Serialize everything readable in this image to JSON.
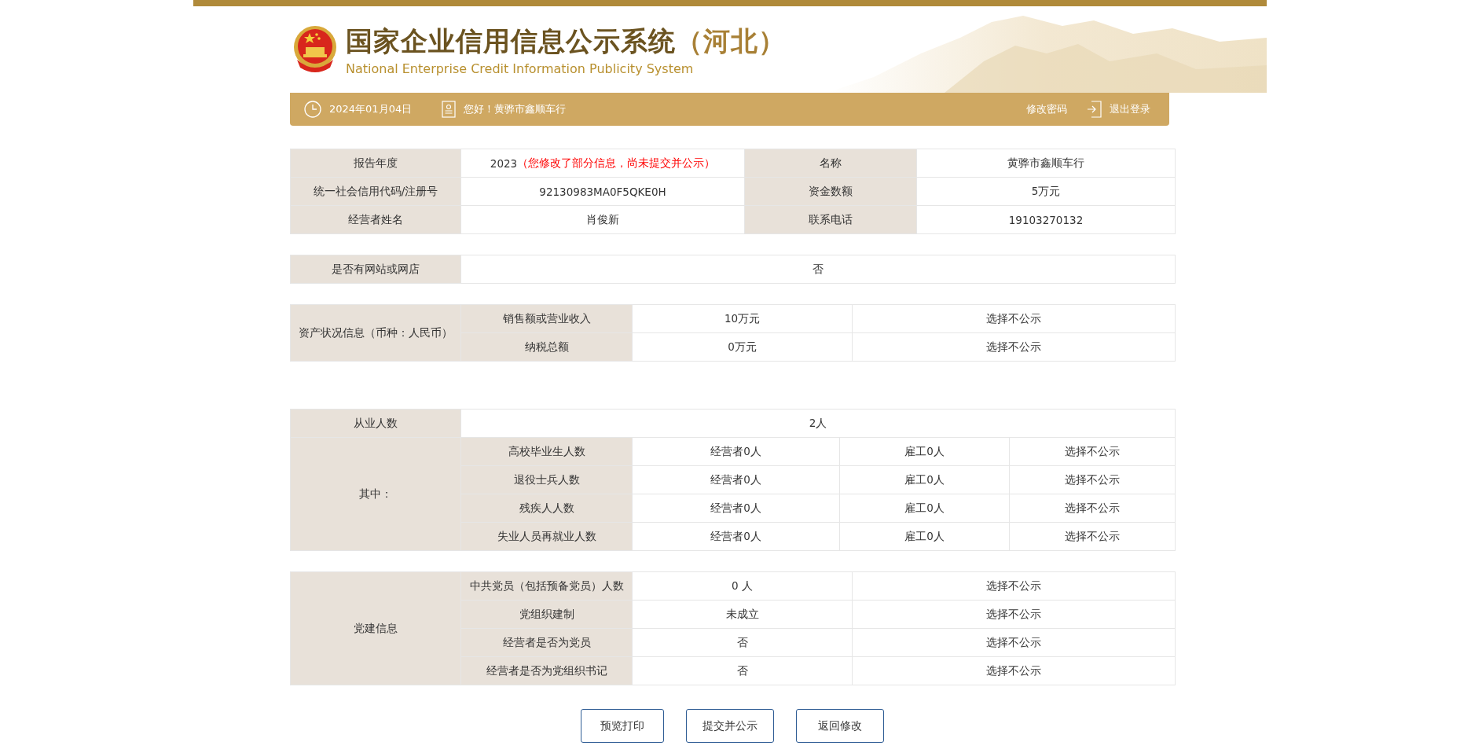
{
  "header": {
    "title": "国家企业信用信息公示系统",
    "region": "（河北）",
    "subtitle": "National Enterprise Credit Information Publicity System"
  },
  "nav": {
    "date": "2024年01月04日",
    "greeting": "您好！黄骅市鑫顺车行",
    "change_password": "修改密码",
    "logout": "退出登录"
  },
  "basic_info": [
    {
      "label": "报告年度",
      "value": "2023",
      "note": "（您修改了部分信息，尚未提交并公示）"
    },
    {
      "label": "名称",
      "value": "黄骅市鑫顺车行"
    },
    {
      "label": "统一社会信用代码/注册号",
      "value": "92130983MA0F5QKE0H"
    },
    {
      "label": "资金数额",
      "value": "5万元"
    },
    {
      "label": "经营者姓名",
      "value": "肖俊新"
    },
    {
      "label": "联系电话",
      "value": "19103270132"
    }
  ],
  "website": {
    "label": "是否有网站或网店",
    "value": "否"
  },
  "assets": {
    "label": "资产状况信息（币种：人民币）",
    "rows": [
      {
        "item": "销售额或营业收入",
        "amount": "10万元",
        "publicity": "选择不公示"
      },
      {
        "item": "纳税总额",
        "amount": "0万元",
        "publicity": "选择不公示"
      }
    ]
  },
  "employees": {
    "label": "从业人数",
    "value": "2人",
    "breakdown_label": "其中：",
    "rows": [
      {
        "item": "高校毕业生人数",
        "operator": "经营者0人",
        "hired": "雇工0人",
        "publicity": "选择不公示"
      },
      {
        "item": "退役士兵人数",
        "operator": "经营者0人",
        "hired": "雇工0人",
        "publicity": "选择不公示"
      },
      {
        "item": "残疾人人数",
        "operator": "经营者0人",
        "hired": "雇工0人",
        "publicity": "选择不公示"
      },
      {
        "item": "失业人员再就业人数",
        "operator": "经营者0人",
        "hired": "雇工0人",
        "publicity": "选择不公示"
      }
    ]
  },
  "party": {
    "label": "党建信息",
    "rows": [
      {
        "item": "中共党员（包括预备党员）人数",
        "value": "0 人",
        "publicity": "选择不公示"
      },
      {
        "item": "党组织建制",
        "value": "未成立",
        "publicity": "选择不公示"
      },
      {
        "item": "经营者是否为党员",
        "value": "否",
        "publicity": "选择不公示"
      },
      {
        "item": "经营者是否为党组织书记",
        "value": "否",
        "publicity": "选择不公示"
      }
    ]
  },
  "buttons": [
    "预览打印",
    "提交并公示",
    "返回修改"
  ]
}
